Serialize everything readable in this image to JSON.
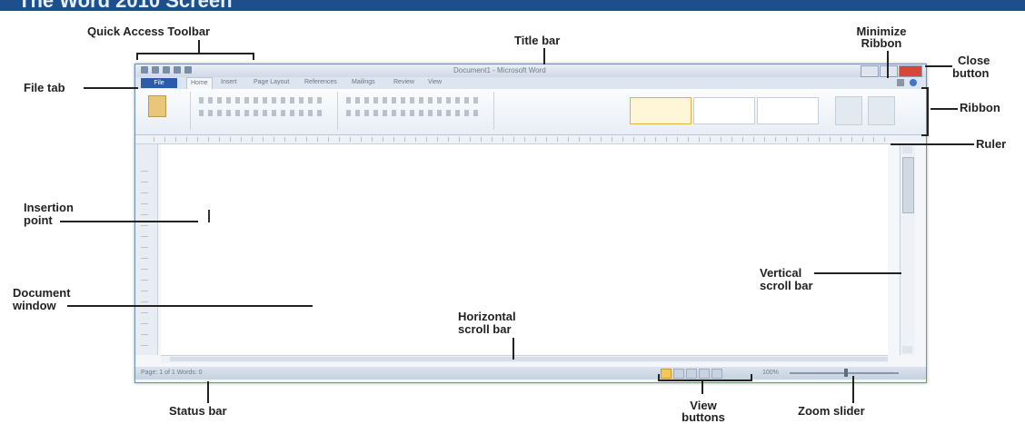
{
  "header": {
    "title": "The Word 2010 Screen"
  },
  "window": {
    "app_title": "Document1 - Microsoft Word",
    "file_tab": "File",
    "tabs": [
      "Home",
      "Insert",
      "Page Layout",
      "References",
      "Mailings",
      "Review",
      "View"
    ],
    "active_tab": "Home",
    "status_text": "Page: 1 of 1   Words: 0",
    "zoom": "100%"
  },
  "labels": {
    "quick_access_toolbar": "Quick Access Toolbar",
    "title_bar": "Title bar",
    "minimize_ribbon_1": "Minimize",
    "minimize_ribbon_2": "Ribbon",
    "close_button_1": "Close",
    "close_button_2": "button",
    "file_tab": "File tab",
    "ribbon": "Ribbon",
    "ruler": "Ruler",
    "insertion_point_1": "Insertion",
    "insertion_point_2": "point",
    "vertical_scroll_bar_1": "Vertical",
    "vertical_scroll_bar_2": "scroll bar",
    "document_window_1": "Document",
    "document_window_2": "window",
    "horizontal_scroll_bar_1": "Horizontal",
    "horizontal_scroll_bar_2": "scroll bar",
    "status_bar": "Status bar",
    "view_buttons_1": "View",
    "view_buttons_2": "buttons",
    "zoom_slider": "Zoom slider"
  }
}
